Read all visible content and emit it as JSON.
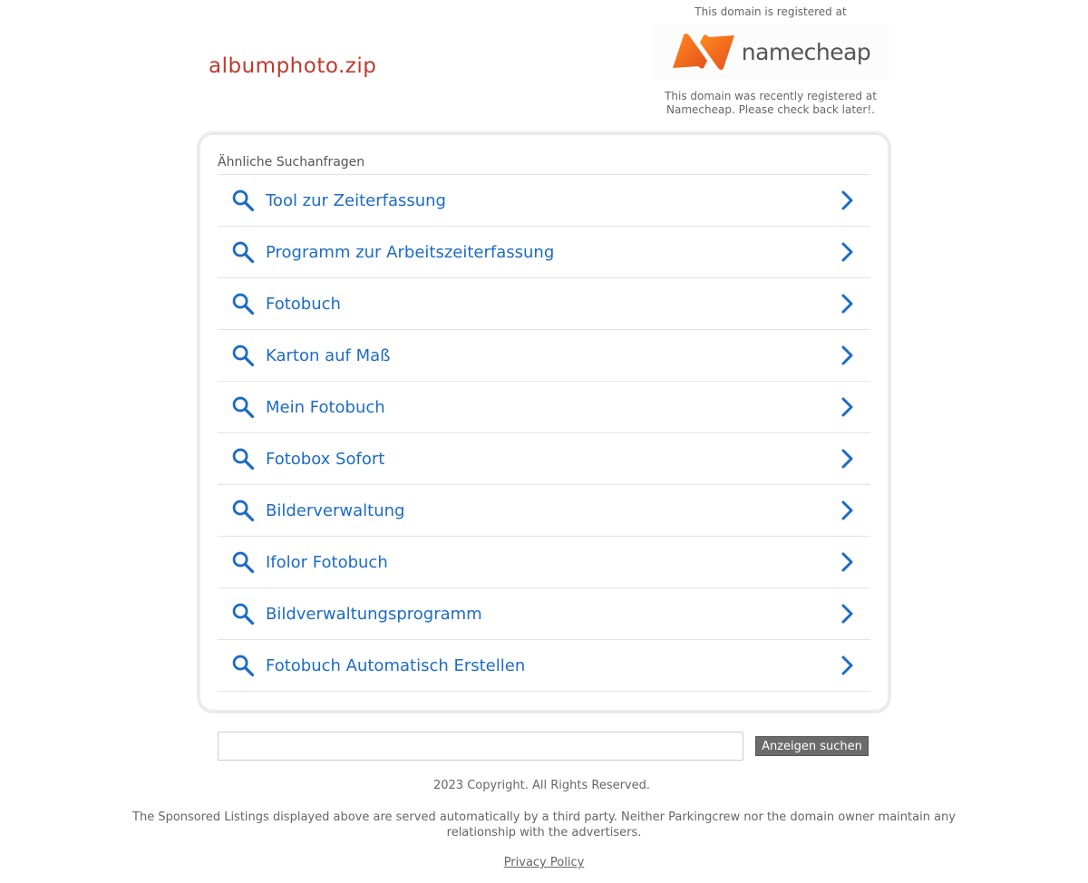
{
  "domain": "albumphoto.zip",
  "registrar": {
    "registered_at": "This domain is registered at",
    "logo_text": "namecheap",
    "notice": "This domain was recently registered at Namecheap. Please check back later!."
  },
  "related": {
    "heading": "Ähnliche Suchanfragen",
    "items": [
      {
        "label": "Tool zur Zeiterfassung"
      },
      {
        "label": "Programm zur Arbeitszeiterfassung"
      },
      {
        "label": "Fotobuch"
      },
      {
        "label": "Karton auf Maß"
      },
      {
        "label": "Mein Fotobuch"
      },
      {
        "label": "Fotobox Sofort"
      },
      {
        "label": "Bilderverwaltung"
      },
      {
        "label": "Ifolor Fotobuch"
      },
      {
        "label": "Bildverwaltungsprogramm"
      },
      {
        "label": "Fotobuch Automatisch Erstellen"
      }
    ]
  },
  "search": {
    "value": "",
    "button_label": "Anzeigen suchen"
  },
  "footer": {
    "copyright": "2023 Copyright. All Rights Reserved.",
    "disclaimer": "The Sponsored Listings displayed above are served automatically by a third party. Neither Parkingcrew nor the domain owner maintain any relationship with the advertisers.",
    "privacy_label": "Privacy Policy"
  },
  "colors": {
    "domain_title": "#c0392b",
    "link_blue": "#1c6bc6",
    "logo_orange": "#f0641e",
    "button_gray": "#6b6b6b"
  },
  "icons": {
    "item_left": "search-icon",
    "item_right": "chevron-right-icon"
  }
}
